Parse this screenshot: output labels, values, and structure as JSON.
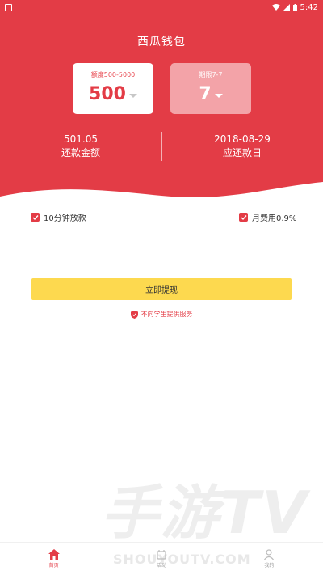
{
  "status_bar": {
    "time": "5:42"
  },
  "app": {
    "title": "西瓜钱包"
  },
  "amount_picker": {
    "label": "额度500-5000",
    "value": "500"
  },
  "term_picker": {
    "label": "期限7-7",
    "value": "7"
  },
  "repayment": {
    "amount": "501.05",
    "amount_label": "还款金额",
    "date": "2018-08-29",
    "date_label": "应还款日"
  },
  "options": {
    "left": "10分钟放款",
    "right": "月费用0.9%"
  },
  "withdraw": {
    "label": "立即提现"
  },
  "notice": {
    "text": "不向学生提供服务"
  },
  "watermark": {
    "text": "手游TV",
    "url": "SHOUYOUTV.COM"
  },
  "tabs": [
    {
      "label": "首页"
    },
    {
      "label": "活动"
    },
    {
      "label": "我的"
    }
  ],
  "colors": {
    "primary_red": "#e33c46",
    "button_yellow": "#fdd94f"
  }
}
